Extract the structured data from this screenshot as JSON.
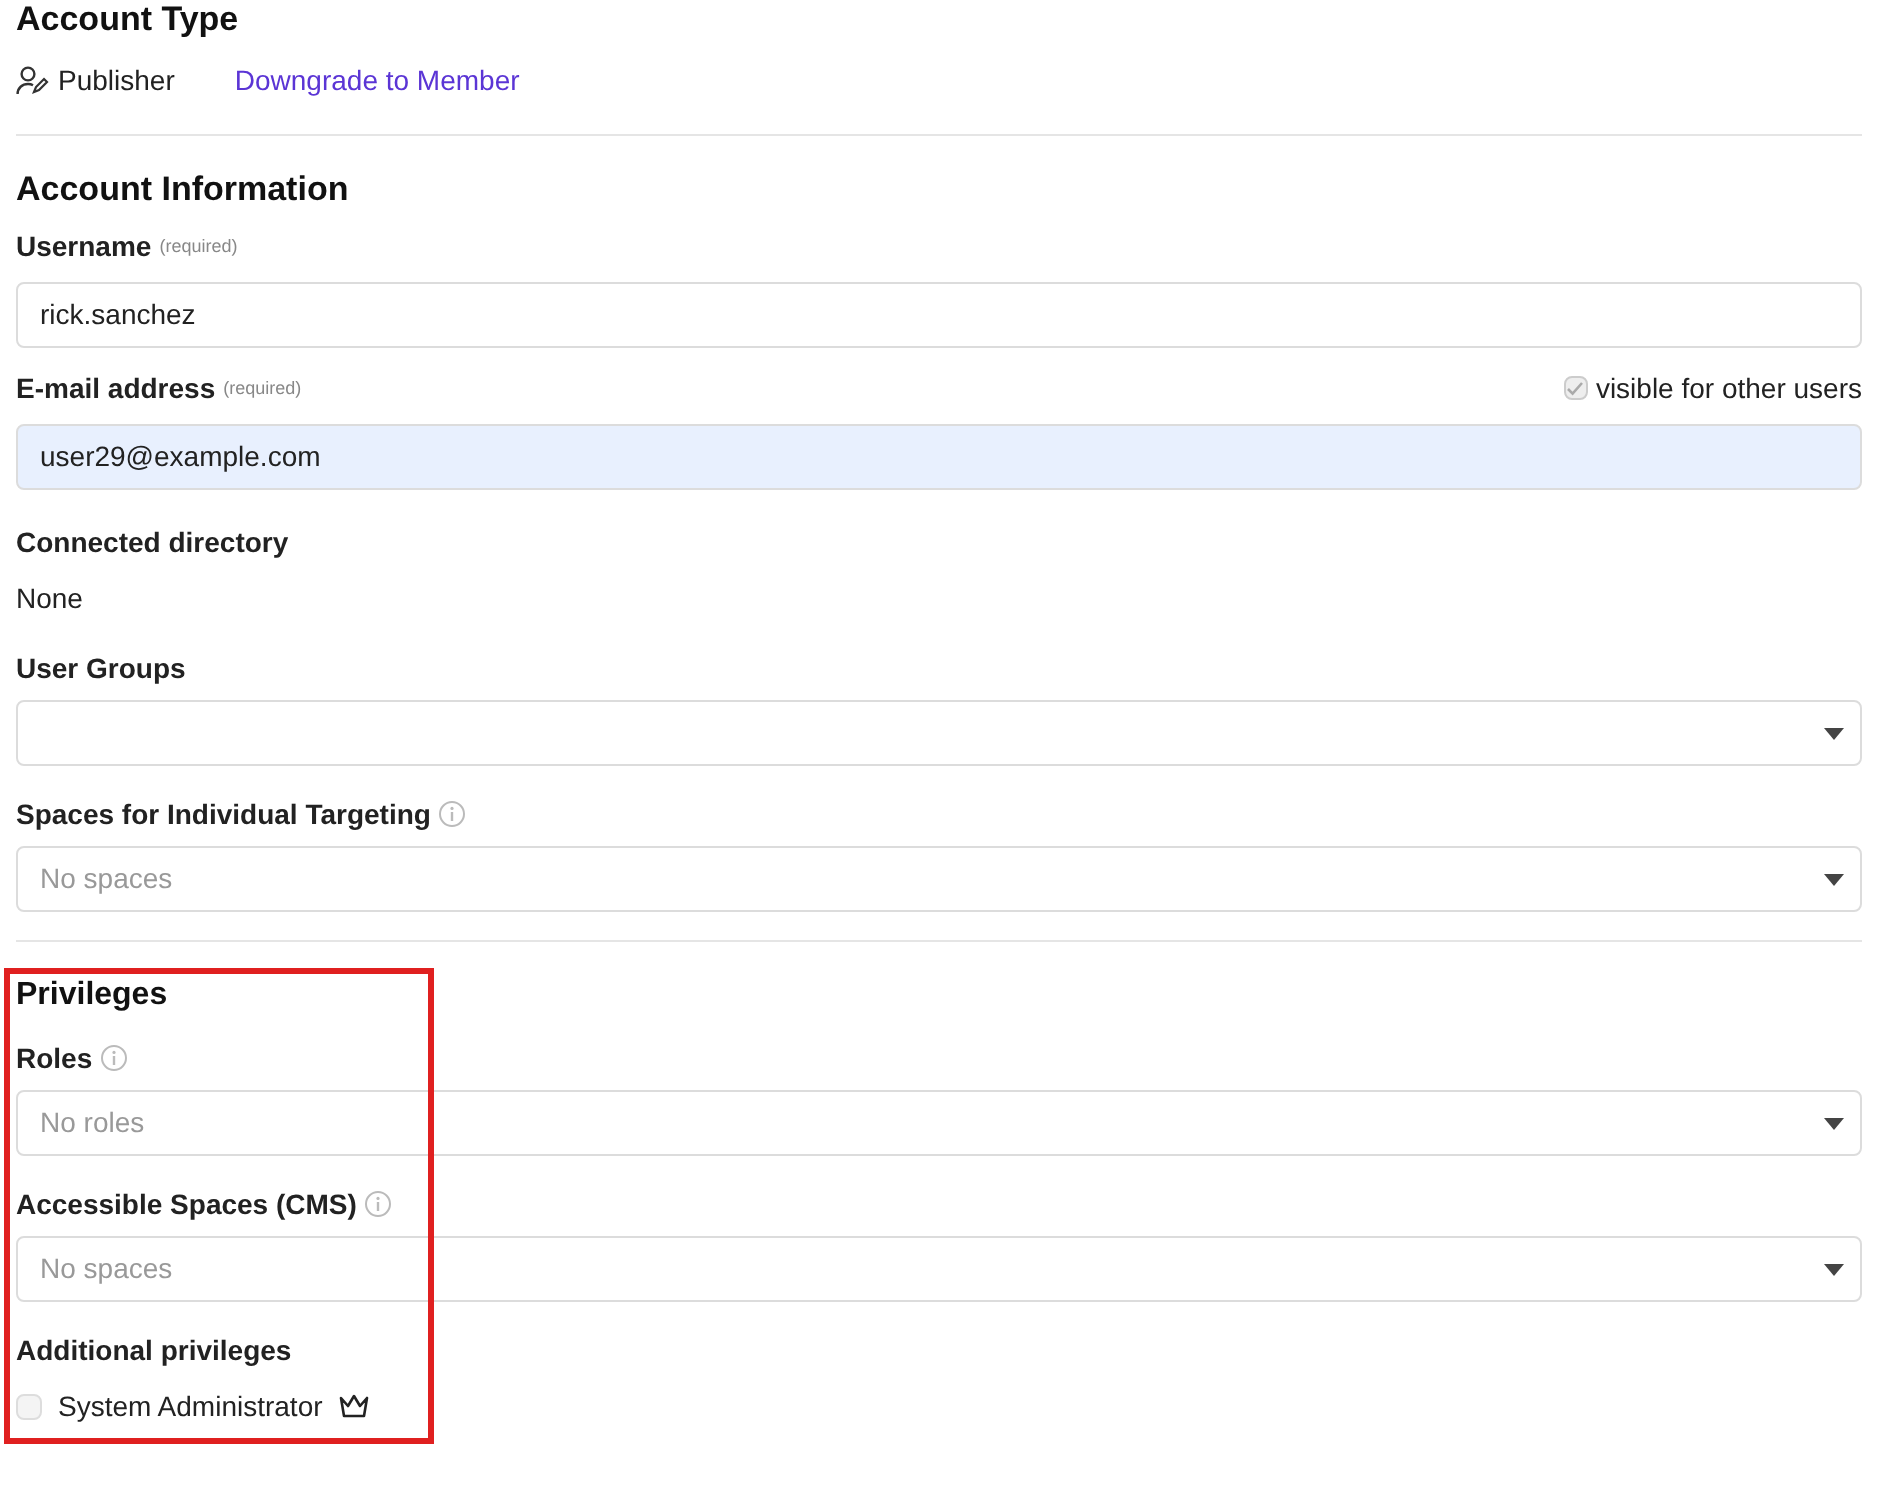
{
  "account_type": {
    "title": "Account Type",
    "type": "Publisher",
    "link": "Downgrade to Member"
  },
  "account_information": {
    "title": "Account Information",
    "fields": [
      {
        "kind": "text",
        "label": "Username",
        "hint": "(required)",
        "value": "rick.sanchez"
      },
      {
        "kind": "text",
        "label": "E-mail address",
        "hint": "(required)",
        "value": "user29@example.com",
        "autofilled": true,
        "option": {
          "label": "visible for other users",
          "checked": true,
          "disabled": true
        }
      },
      {
        "kind": "static",
        "label": "Connected directory",
        "value": "None"
      },
      {
        "kind": "select",
        "label": "User Groups"
      },
      {
        "kind": "select",
        "label": "Spaces for Individual Targeting",
        "info": true,
        "placeholder": "No spaces"
      }
    ]
  },
  "privileges": {
    "title": "Privileges",
    "highlighted": true,
    "fields": [
      {
        "kind": "select",
        "label": "Roles",
        "info": true,
        "placeholder": "No roles"
      },
      {
        "kind": "select",
        "label": "Accessible Spaces (CMS)",
        "info": true,
        "placeholder": "No spaces"
      },
      {
        "kind": "checks",
        "label": "Additional privileges",
        "items": [
          {
            "label": "System Administrator",
            "checked": false
          }
        ]
      }
    ]
  }
}
